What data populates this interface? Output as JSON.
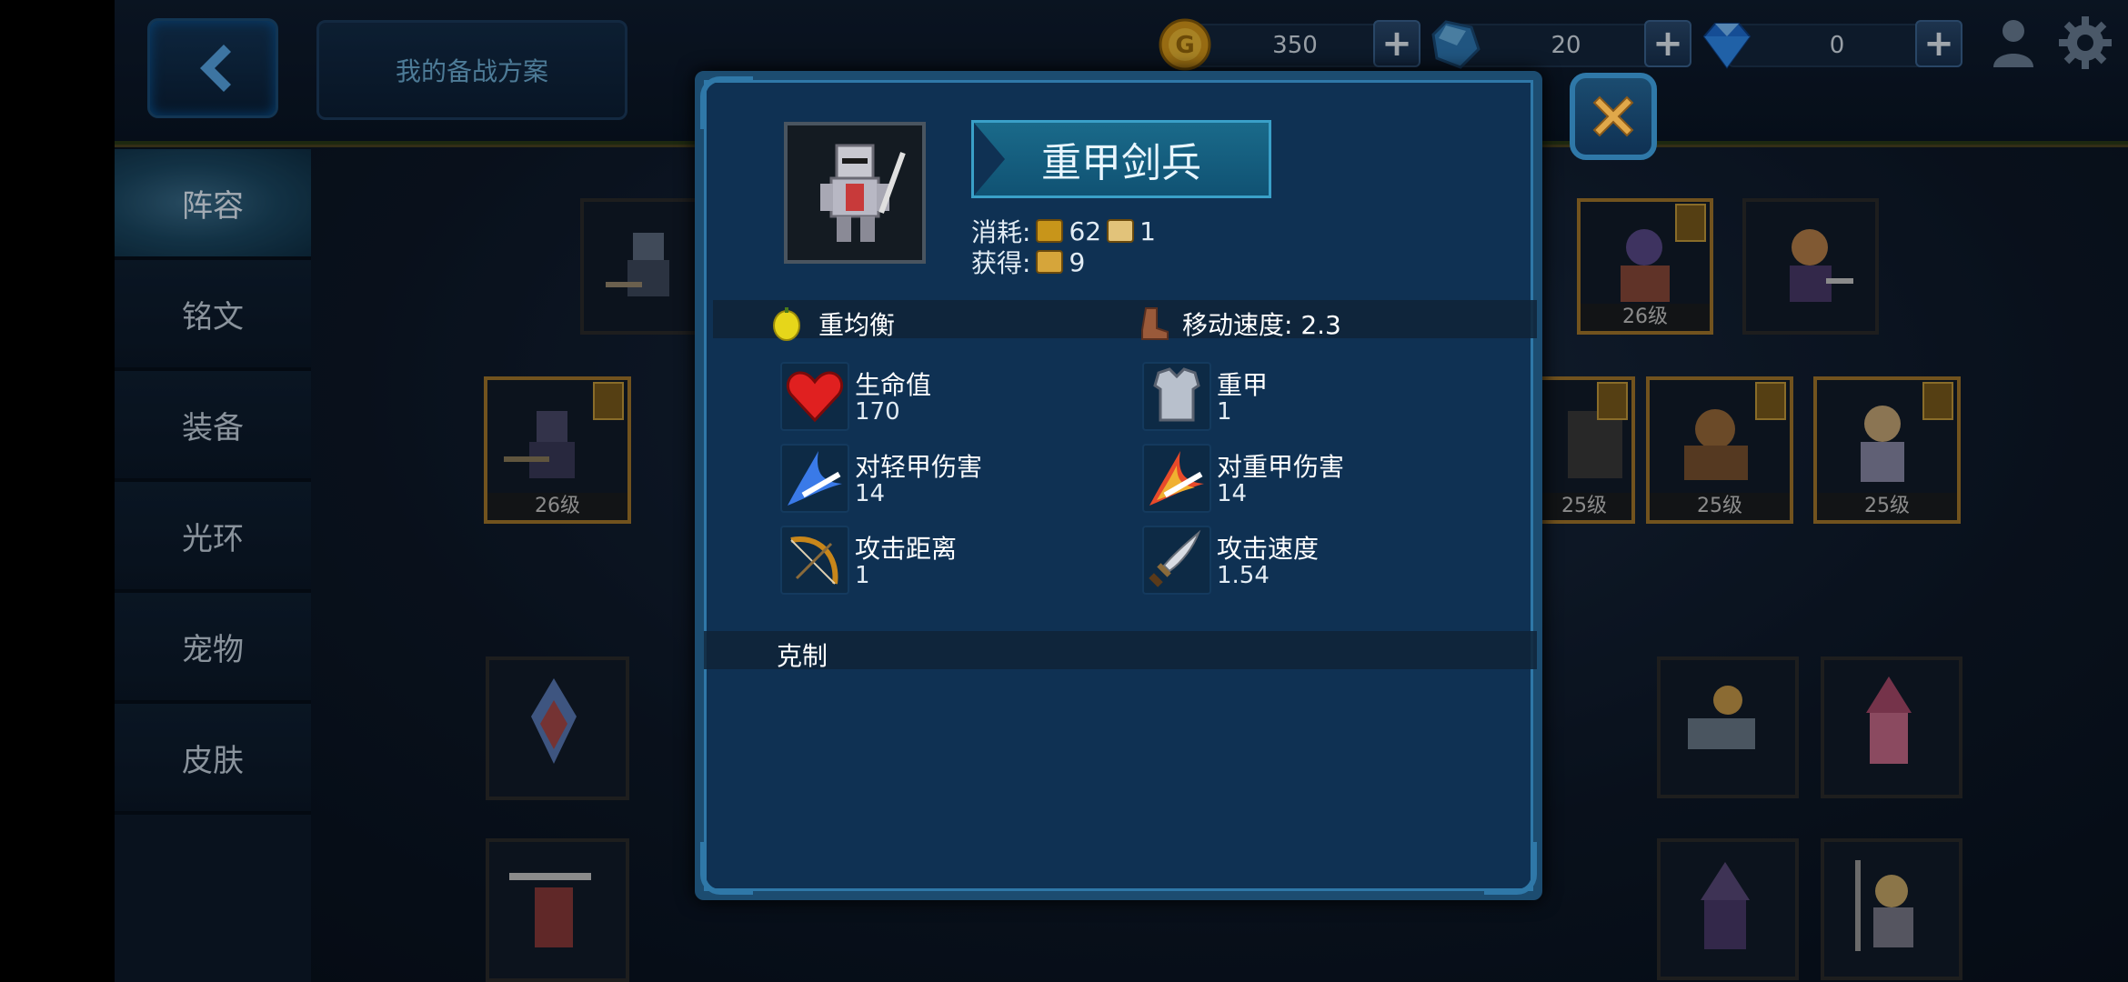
{
  "topbar": {
    "plan_label": "我的备战方案",
    "gold": "350",
    "crystal": "20",
    "diamond": "0",
    "plus": "+"
  },
  "sidebar": {
    "tabs": [
      {
        "label": "阵容"
      },
      {
        "label": "铭文"
      },
      {
        "label": "装备"
      },
      {
        "label": "光环"
      },
      {
        "label": "宠物"
      },
      {
        "label": "皮肤"
      }
    ]
  },
  "grid": {
    "levels": {
      "r1c7": "26级",
      "r2c1": "26级",
      "r2c5": "25级",
      "r2c6": "25级",
      "r2c7": "25级"
    }
  },
  "dialog": {
    "unit_name": "重甲剑兵",
    "cost_label": "消耗:",
    "cost_gold": "62",
    "cost_supply": "1",
    "gain_label": "获得:",
    "gain_value": "9",
    "armor_class": "重均衡",
    "speed_label": "移动速度: 2.3",
    "stats": [
      {
        "label": "生命值",
        "value": "170",
        "icon": "heart-icon"
      },
      {
        "label": "重甲",
        "value": "1",
        "icon": "armor-icon"
      },
      {
        "label": "对轻甲伤害",
        "value": "14",
        "icon": "blue-slash-icon"
      },
      {
        "label": "对重甲伤害",
        "value": "14",
        "icon": "red-slash-icon"
      },
      {
        "label": "攻击距离",
        "value": "1",
        "icon": "bow-icon"
      },
      {
        "label": "攻击速度",
        "value": "1.54",
        "icon": "dagger-icon"
      }
    ],
    "counter_label": "克制",
    "close_icon": "close-icon"
  },
  "colors": {
    "dialog_bg": "#0f3153",
    "dialog_border": "#2f78a8",
    "gold_border": "#a4772b",
    "close_x": "#e0a84a"
  }
}
